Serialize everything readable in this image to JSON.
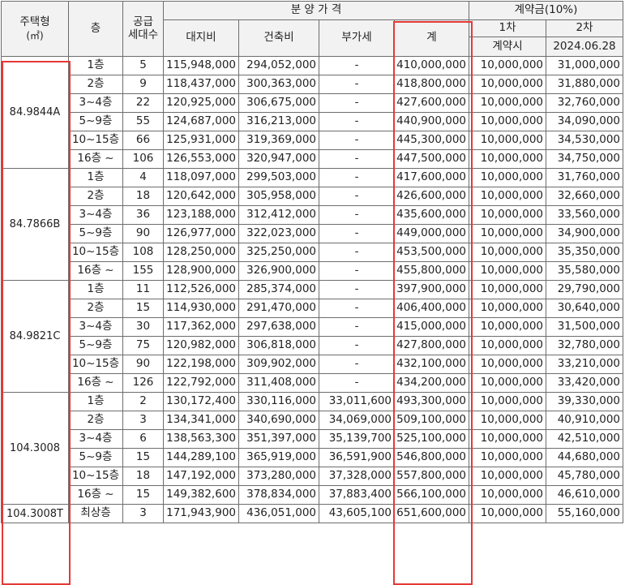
{
  "header": {
    "type_label": "주택형",
    "type_unit": "(㎡)",
    "floor_label": "층",
    "supply_label_1": "공급",
    "supply_label_2": "세대수",
    "price_group": "분 양 가 격",
    "land": "대지비",
    "building": "건축비",
    "vat": "부가세",
    "total": "계",
    "deposit_group": "계약금(10%)",
    "first": "1차",
    "second": "2차",
    "first_when": "계약시",
    "second_when": "2024.06.28"
  },
  "groups": [
    {
      "type": "84.9844A",
      "rows": [
        {
          "floor": "1층",
          "units": "5",
          "land": "115,948,000",
          "building": "294,052,000",
          "vat": "-",
          "total": "410,000,000",
          "first": "10,000,000",
          "second": "31,000,000"
        },
        {
          "floor": "2층",
          "units": "9",
          "land": "118,437,000",
          "building": "300,363,000",
          "vat": "-",
          "total": "418,800,000",
          "first": "10,000,000",
          "second": "31,880,000"
        },
        {
          "floor": "3~4층",
          "units": "22",
          "land": "120,925,000",
          "building": "306,675,000",
          "vat": "-",
          "total": "427,600,000",
          "first": "10,000,000",
          "second": "32,760,000"
        },
        {
          "floor": "5~9층",
          "units": "55",
          "land": "124,687,000",
          "building": "316,213,000",
          "vat": "-",
          "total": "440,900,000",
          "first": "10,000,000",
          "second": "34,090,000"
        },
        {
          "floor": "10~15층",
          "units": "66",
          "land": "125,931,000",
          "building": "319,369,000",
          "vat": "-",
          "total": "445,300,000",
          "first": "10,000,000",
          "second": "34,530,000"
        },
        {
          "floor": "16층 ~",
          "units": "106",
          "land": "126,553,000",
          "building": "320,947,000",
          "vat": "-",
          "total": "447,500,000",
          "first": "10,000,000",
          "second": "34,750,000"
        }
      ]
    },
    {
      "type": "84.7866B",
      "rows": [
        {
          "floor": "1층",
          "units": "4",
          "land": "118,097,000",
          "building": "299,503,000",
          "vat": "-",
          "total": "417,600,000",
          "first": "10,000,000",
          "second": "31,760,000"
        },
        {
          "floor": "2층",
          "units": "18",
          "land": "120,642,000",
          "building": "305,958,000",
          "vat": "-",
          "total": "426,600,000",
          "first": "10,000,000",
          "second": "32,660,000"
        },
        {
          "floor": "3~4층",
          "units": "36",
          "land": "123,188,000",
          "building": "312,412,000",
          "vat": "-",
          "total": "435,600,000",
          "first": "10,000,000",
          "second": "33,560,000"
        },
        {
          "floor": "5~9층",
          "units": "90",
          "land": "126,977,000",
          "building": "322,023,000",
          "vat": "-",
          "total": "449,000,000",
          "first": "10,000,000",
          "second": "34,900,000"
        },
        {
          "floor": "10~15층",
          "units": "108",
          "land": "128,250,000",
          "building": "325,250,000",
          "vat": "-",
          "total": "453,500,000",
          "first": "10,000,000",
          "second": "35,350,000"
        },
        {
          "floor": "16층 ~",
          "units": "155",
          "land": "128,900,000",
          "building": "326,900,000",
          "vat": "-",
          "total": "455,800,000",
          "first": "10,000,000",
          "second": "35,580,000"
        }
      ]
    },
    {
      "type": "84.9821C",
      "rows": [
        {
          "floor": "1층",
          "units": "11",
          "land": "112,526,000",
          "building": "285,374,000",
          "vat": "-",
          "total": "397,900,000",
          "first": "10,000,000",
          "second": "29,790,000"
        },
        {
          "floor": "2층",
          "units": "15",
          "land": "114,930,000",
          "building": "291,470,000",
          "vat": "-",
          "total": "406,400,000",
          "first": "10,000,000",
          "second": "30,640,000"
        },
        {
          "floor": "3~4층",
          "units": "30",
          "land": "117,362,000",
          "building": "297,638,000",
          "vat": "-",
          "total": "415,000,000",
          "first": "10,000,000",
          "second": "31,500,000"
        },
        {
          "floor": "5~9층",
          "units": "75",
          "land": "120,982,000",
          "building": "306,818,000",
          "vat": "-",
          "total": "427,800,000",
          "first": "10,000,000",
          "second": "32,780,000"
        },
        {
          "floor": "10~15층",
          "units": "90",
          "land": "122,198,000",
          "building": "309,902,000",
          "vat": "-",
          "total": "432,100,000",
          "first": "10,000,000",
          "second": "33,210,000"
        },
        {
          "floor": "16층 ~",
          "units": "126",
          "land": "122,792,000",
          "building": "311,408,000",
          "vat": "-",
          "total": "434,200,000",
          "first": "10,000,000",
          "second": "33,420,000"
        }
      ]
    },
    {
      "type": "104.3008",
      "rows": [
        {
          "floor": "1층",
          "units": "2",
          "land": "130,172,400",
          "building": "330,116,000",
          "vat": "33,011,600",
          "total": "493,300,000",
          "first": "10,000,000",
          "second": "39,330,000"
        },
        {
          "floor": "2층",
          "units": "3",
          "land": "134,341,000",
          "building": "340,690,000",
          "vat": "34,069,000",
          "total": "509,100,000",
          "first": "10,000,000",
          "second": "40,910,000"
        },
        {
          "floor": "3~4층",
          "units": "6",
          "land": "138,563,300",
          "building": "351,397,000",
          "vat": "35,139,700",
          "total": "525,100,000",
          "first": "10,000,000",
          "second": "42,510,000"
        },
        {
          "floor": "5~9층",
          "units": "15",
          "land": "144,289,100",
          "building": "365,919,000",
          "vat": "36,591,900",
          "total": "546,800,000",
          "first": "10,000,000",
          "second": "44,680,000"
        },
        {
          "floor": "10~15층",
          "units": "18",
          "land": "147,192,000",
          "building": "373,280,000",
          "vat": "37,328,000",
          "total": "557,800,000",
          "first": "10,000,000",
          "second": "45,780,000"
        },
        {
          "floor": "16층 ~",
          "units": "15",
          "land": "149,382,600",
          "building": "378,834,000",
          "vat": "37,883,400",
          "total": "566,100,000",
          "first": "10,000,000",
          "second": "46,610,000"
        }
      ]
    },
    {
      "type": "104.3008T",
      "rows": [
        {
          "floor": "최상층",
          "units": "3",
          "land": "171,943,900",
          "building": "436,051,000",
          "vat": "43,605,100",
          "total": "651,600,000",
          "first": "10,000,000",
          "second": "55,160,000"
        }
      ]
    }
  ],
  "highlight_color": "#e53935",
  "border_color": "#6d6d6d",
  "header_bg": "#f2f2f2"
}
